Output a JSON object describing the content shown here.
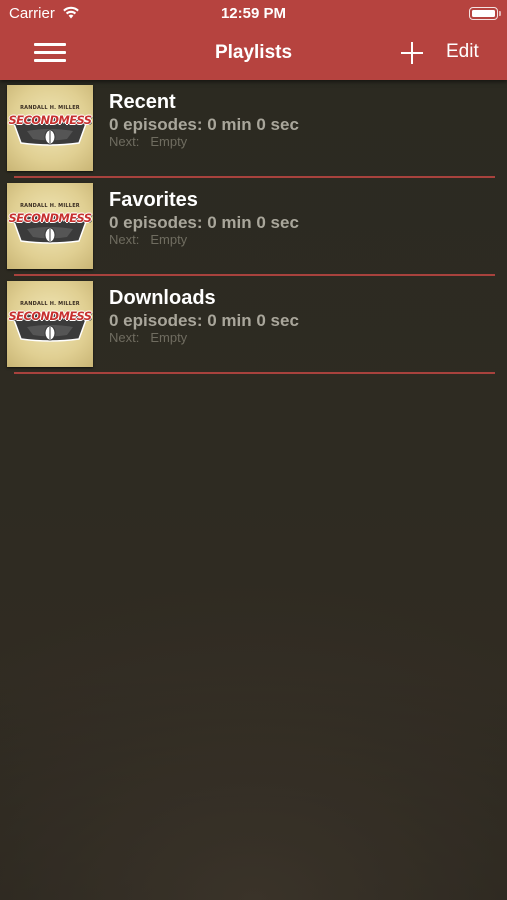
{
  "status_bar": {
    "carrier": "Carrier",
    "time": "12:59 PM",
    "battery_level": 1.0
  },
  "nav": {
    "title": "Playlists",
    "menu_icon": "hamburger-menu-icon",
    "add_icon": "plus-icon",
    "edit_label": "Edit"
  },
  "colors": {
    "bar": "#b6433f",
    "separator": "#a8423d",
    "background": "#2e2b22",
    "summary_text": "#a9a69b",
    "next_text": "#6f6c60"
  },
  "artwork": {
    "subtitle": "RANDALL H. MILLER",
    "brand": "SECONDMESS"
  },
  "playlists": [
    {
      "title": "Recent",
      "summary": "0 episodes: 0 min 0 sec",
      "next_label": "Next:",
      "next_value": "Empty"
    },
    {
      "title": "Favorites",
      "summary": "0 episodes: 0 min 0 sec",
      "next_label": "Next:",
      "next_value": "Empty"
    },
    {
      "title": "Downloads",
      "summary": "0 episodes: 0 min 0 sec",
      "next_label": "Next:",
      "next_value": "Empty"
    }
  ]
}
